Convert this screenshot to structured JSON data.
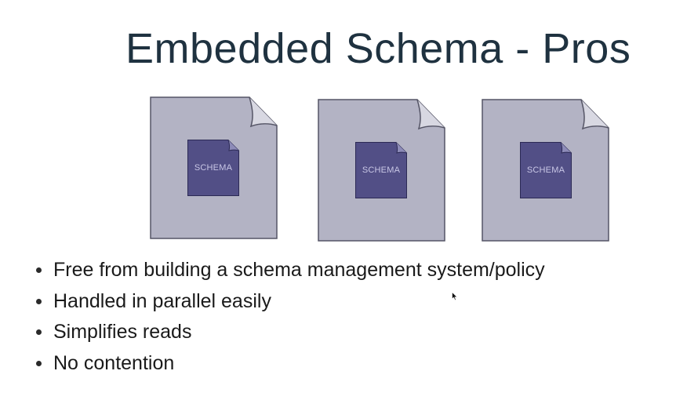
{
  "slide": {
    "title": "Embedded Schema - Pros"
  },
  "documents": [
    {
      "icon": "document-icon",
      "schema_label": "SCHEMA"
    },
    {
      "icon": "document-icon",
      "schema_label": "SCHEMA"
    },
    {
      "icon": "document-icon",
      "schema_label": "SCHEMA"
    }
  ],
  "bullets": [
    "Free from building a schema management system/policy",
    "Handled in parallel easily",
    "Simplifies reads",
    "No contention"
  ],
  "colors": {
    "title": "#1f3240",
    "document_fill": "#b3b3c4",
    "schema_fill": "#524f86",
    "schema_text": "#c9c7e6"
  }
}
